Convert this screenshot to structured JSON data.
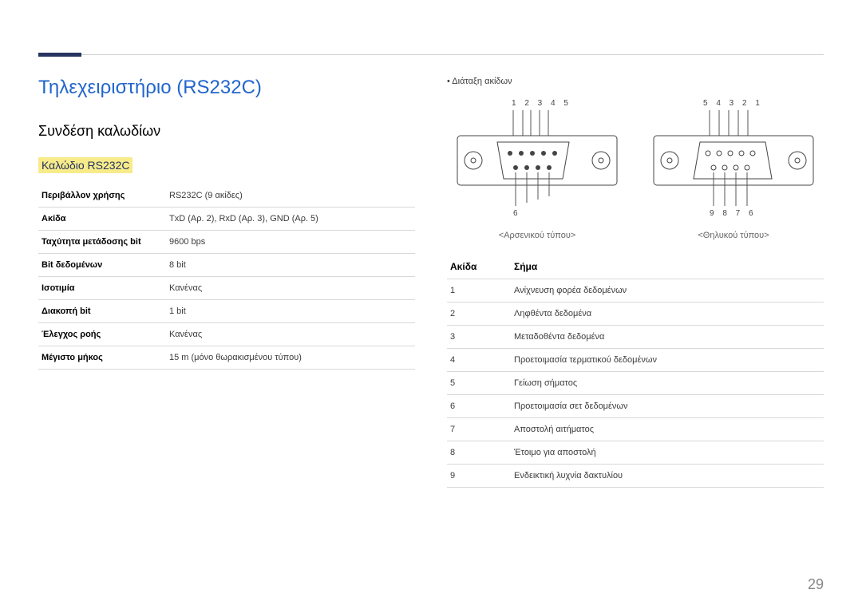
{
  "page_number": "29",
  "h1": "Τηλεχειριστήριο (RS232C)",
  "h2": "Συνδέση καλωδίων",
  "h3": "Καλώδιο RS232C",
  "spec_rows": [
    {
      "k": "Περιβάλλον χρήσης",
      "v": "RS232C (9 ακίδες)"
    },
    {
      "k": "Ακίδα",
      "v": "TxD (Αρ. 2), RxD (Αρ. 3), GND (Αρ. 5)"
    },
    {
      "k": "Ταχύτητα μετάδοσης bit",
      "v": "9600 bps"
    },
    {
      "k": "Bit δεδομένων",
      "v": "8 bit"
    },
    {
      "k": "Ισοτιμία",
      "v": "Κανένας"
    },
    {
      "k": "Διακοπή bit",
      "v": "1 bit"
    },
    {
      "k": "Έλεγχος ροής",
      "v": "Κανένας"
    },
    {
      "k": "Μέγιστο μήκος",
      "v": "15 m (μόνο θωρακισμένου τύπου)"
    }
  ],
  "bullet": "• Διάταξη ακίδων",
  "male_nums_top": "1 2 3 4 5",
  "male_nums_bot": "6",
  "male_label": "<Αρσενικού τύπου>",
  "female_nums_top": "5 4 3 2 1",
  "female_nums_bot": "9 8 7 6",
  "female_label": "<Θηλυκού τύπου>",
  "pin_header_pin": "Ακίδα",
  "pin_header_signal": "Σήμα",
  "pin_rows": [
    {
      "n": "1",
      "s": "Ανίχνευση φορέα δεδομένων"
    },
    {
      "n": "2",
      "s": "Ληφθέντα δεδομένα"
    },
    {
      "n": "3",
      "s": "Μεταδοθέντα δεδομένα"
    },
    {
      "n": "4",
      "s": "Προετοιμασία τερματικού δεδομένων"
    },
    {
      "n": "5",
      "s": "Γείωση σήματος"
    },
    {
      "n": "6",
      "s": "Προετοιμασία σετ δεδομένων"
    },
    {
      "n": "7",
      "s": "Αποστολή αιτήματος"
    },
    {
      "n": "8",
      "s": "Έτοιμο για αποστολή"
    },
    {
      "n": "9",
      "s": "Ενδεικτική λυχνία δακτυλίου"
    }
  ]
}
